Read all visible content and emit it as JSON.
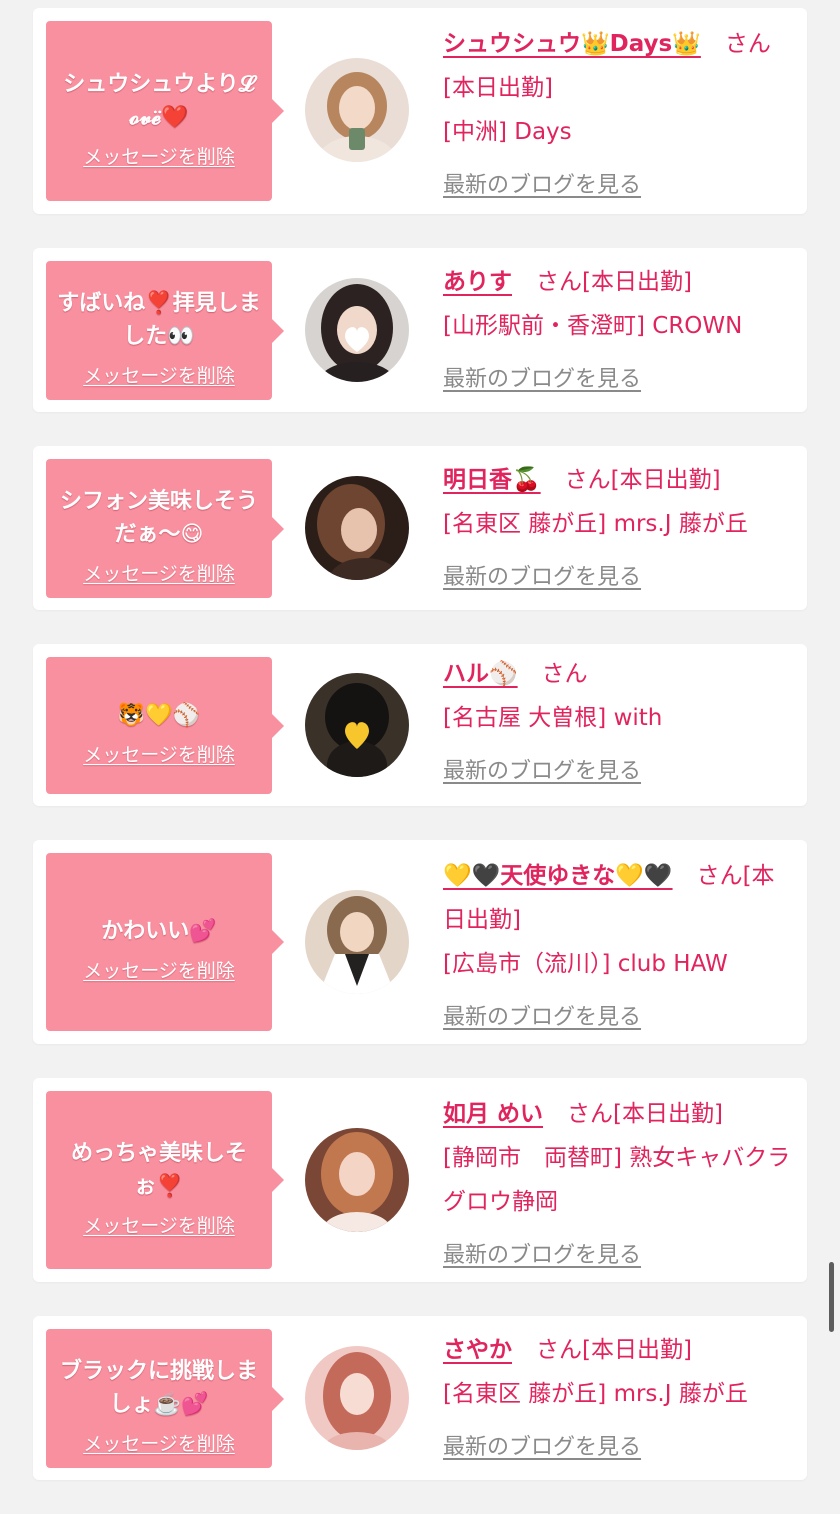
{
  "delete_label": "メッセージを削除",
  "blog_label": "最新のブログを見る",
  "san": "さん",
  "cards": [
    {
      "message": "シュウシュウより𝓛𝓸𝓿𝓮̈❤️",
      "name": "シュウシュウ👑Days👑",
      "status": "[本日出勤]",
      "shop": "[中洲] Days",
      "avatar_color": "#d8c6bd"
    },
    {
      "message": "すばいね❣️拝見しました👀",
      "name": "ありす",
      "status": "[本日出勤]",
      "shop": "[山形駅前・香澄町] CROWN",
      "avatar_color": "#3a3030"
    },
    {
      "message": "シフォン美味しそうだぁ～😋",
      "name": "明日香🍒",
      "status": "[本日出勤]",
      "shop": "[名東区 藤が丘] mrs.J 藤が丘",
      "avatar_color": "#3b2a22"
    },
    {
      "message": "🐯💛⚾️",
      "name": "ハル⚾️",
      "status": "",
      "shop": "[名古屋 大曽根] with",
      "avatar_color": "#2a2520"
    },
    {
      "message": "かわいい💕",
      "name": "💛🖤天使ゆきな💛🖤",
      "status": "[本日出勤]",
      "shop": "[広島市（流川）] club HAW",
      "avatar_color": "#c4a58c"
    },
    {
      "message": "めっちゃ美味しそぉ❣️",
      "name": "如月 めい",
      "status": "[本日出勤]",
      "shop": "[静岡市　両替町] 熟女キャバクラ グロウ静岡",
      "avatar_color": "#b86e55"
    },
    {
      "message": "ブラックに挑戦しましょ☕️💕",
      "name": "さやか",
      "status": "[本日出勤]",
      "shop": "[名東区 藤が丘] mrs.J 藤が丘",
      "avatar_color": "#d9928f"
    }
  ]
}
